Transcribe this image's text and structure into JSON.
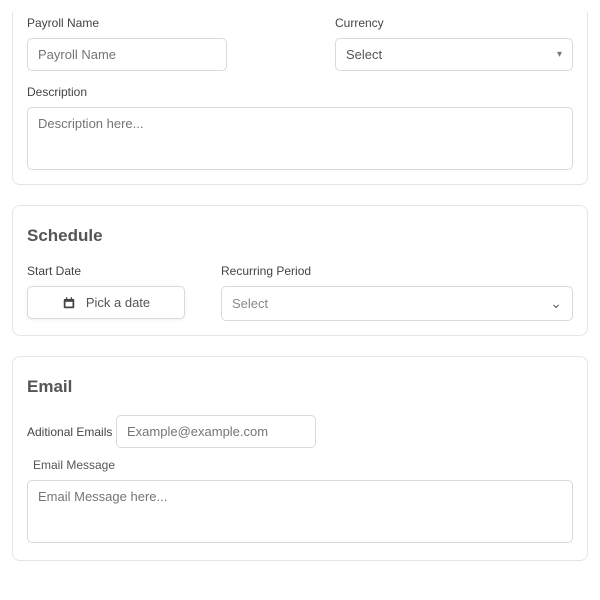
{
  "details": {
    "payroll_name_label": "Payroll Name",
    "payroll_name_placeholder": "Payroll Name",
    "payroll_name_value": "",
    "currency_label": "Currency",
    "currency_selected": "Select",
    "description_label": "Description",
    "description_placeholder": "Description here...",
    "description_value": ""
  },
  "schedule": {
    "title": "Schedule",
    "start_date_label": "Start Date",
    "pick_date_text": "Pick a date",
    "recurring_label": "Recurring Period",
    "recurring_selected": "Select"
  },
  "email": {
    "title": "Email",
    "additional_label": "Aditional Emails",
    "additional_placeholder": "Example@example.com",
    "additional_value": "",
    "message_label": "Email Message",
    "message_placeholder": "Email Message here...",
    "message_value": ""
  }
}
